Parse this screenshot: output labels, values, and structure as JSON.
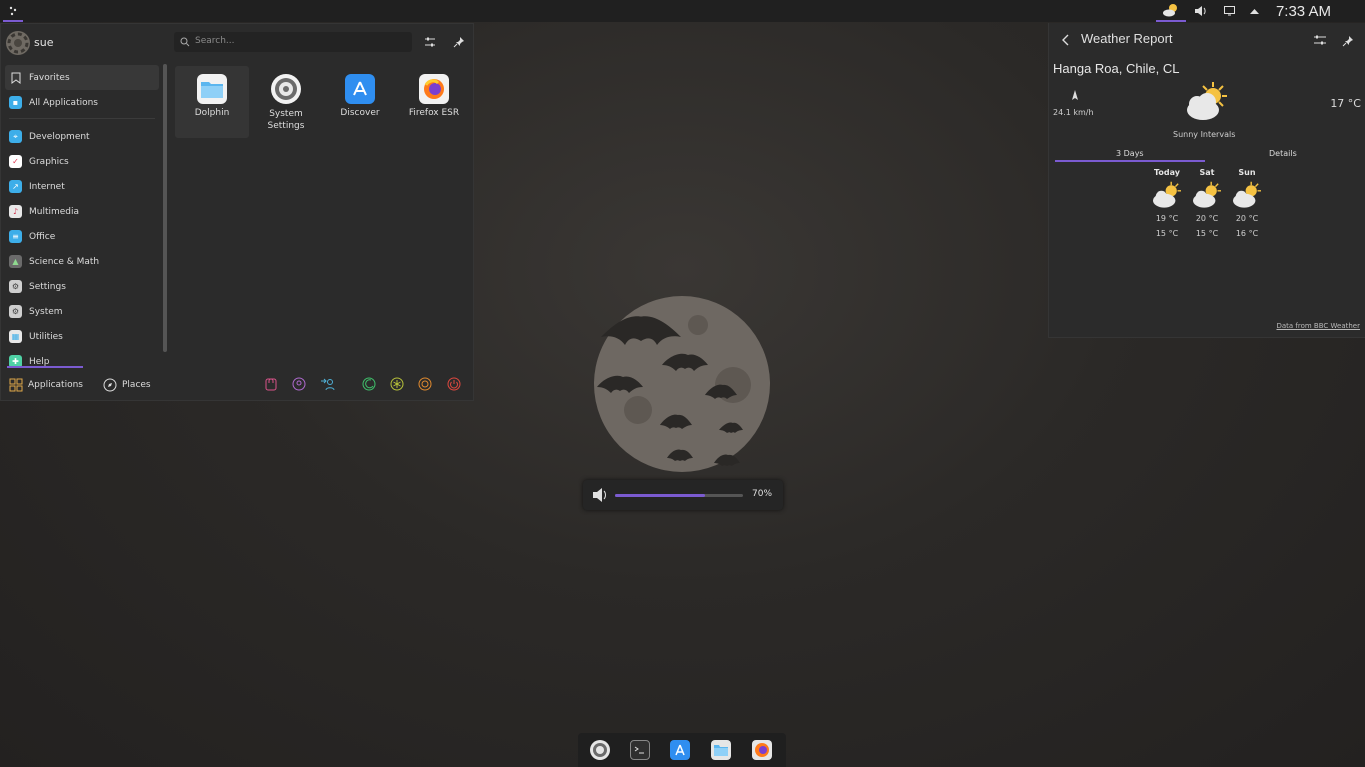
{
  "panel": {
    "clock": "7:33 AM"
  },
  "kickoff": {
    "username": "sue",
    "search_placeholder": "Search...",
    "categories": [
      {
        "label": "Favorites",
        "color": "#2b2b2b"
      },
      {
        "label": "All Applications",
        "color": "#3daee9"
      },
      {
        "label": "Development",
        "color": "#3daee9"
      },
      {
        "label": "Graphics",
        "color": "#ffffff"
      },
      {
        "label": "Internet",
        "color": "#3daee9"
      },
      {
        "label": "Multimedia",
        "color": "#e8e8e8"
      },
      {
        "label": "Office",
        "color": "#3daee9"
      },
      {
        "label": "Science & Math",
        "color": "#6b6b6b"
      },
      {
        "label": "Settings",
        "color": "#cfcfcf"
      },
      {
        "label": "System",
        "color": "#cfcfcf"
      },
      {
        "label": "Utilities",
        "color": "#e8e8e8"
      },
      {
        "label": "Help",
        "color": "#4fd1a5"
      }
    ],
    "apps": [
      {
        "label": "Dolphin"
      },
      {
        "label": "System\nSettings"
      },
      {
        "label": "Discover"
      },
      {
        "label": "Firefox ESR"
      }
    ],
    "footer": {
      "applications_tab": "Applications",
      "places_tab": "Places"
    }
  },
  "weather": {
    "title": "Weather Report",
    "location": "Hanga Roa, Chile, CL",
    "wind": "24.1 km/h",
    "temperature": "17 °C",
    "condition": "Sunny Intervals",
    "tabs": [
      "3 Days",
      "Details"
    ],
    "forecast": [
      {
        "day": "Today",
        "high": "19 °C",
        "low": "15 °C"
      },
      {
        "day": "Sat",
        "high": "20 °C",
        "low": "15 °C"
      },
      {
        "day": "Sun",
        "high": "20 °C",
        "low": "16 °C"
      }
    ],
    "source": "Data from BBC Weather"
  },
  "volume": {
    "label": "70%",
    "level": 0.7
  },
  "colors": {
    "accent": "#7b5bd1"
  }
}
